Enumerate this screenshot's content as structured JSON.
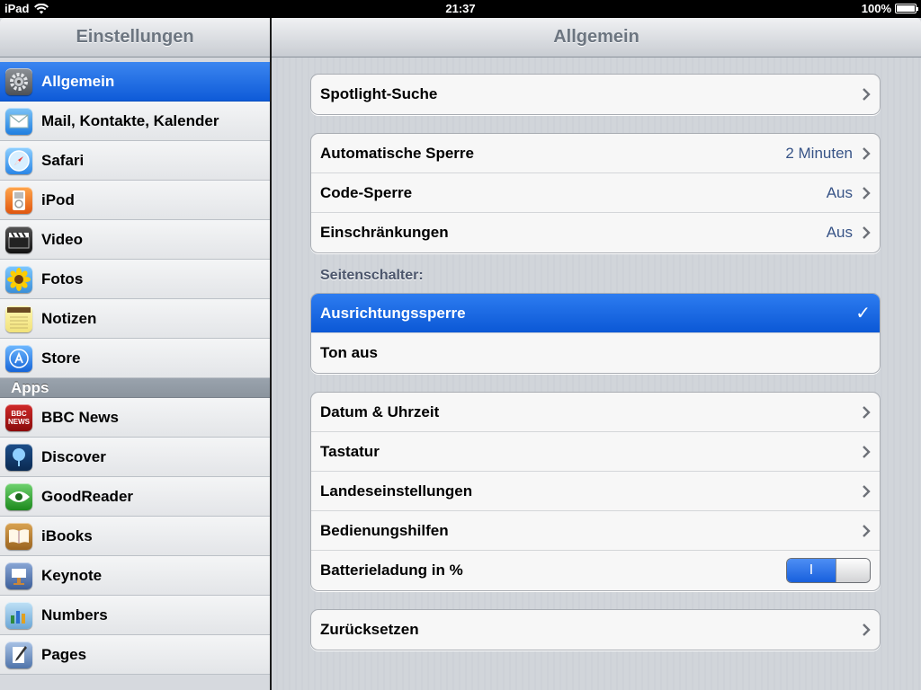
{
  "status": {
    "device": "iPad",
    "time": "21:37",
    "battery": "100%",
    "battery_level": 1.0
  },
  "master": {
    "title": "Einstellungen",
    "items": [
      {
        "label": "Allgemein",
        "icon": "gear-icon",
        "selected": true
      },
      {
        "label": "Mail, Kontakte, Kalender",
        "icon": "mail-icon"
      },
      {
        "label": "Safari",
        "icon": "compass-icon"
      },
      {
        "label": "iPod",
        "icon": "ipod-icon"
      },
      {
        "label": "Video",
        "icon": "clapperboard-icon"
      },
      {
        "label": "Fotos",
        "icon": "sunflower-icon"
      },
      {
        "label": "Notizen",
        "icon": "notepad-icon"
      },
      {
        "label": "Store",
        "icon": "app-store-icon"
      }
    ],
    "apps_header": "Apps",
    "apps": [
      {
        "label": "BBC News",
        "icon": "bbc-news-icon",
        "icon_text": "BBC NEWS"
      },
      {
        "label": "Discover",
        "icon": "tree-icon"
      },
      {
        "label": "GoodReader",
        "icon": "eye-icon"
      },
      {
        "label": "iBooks",
        "icon": "book-icon"
      },
      {
        "label": "Keynote",
        "icon": "keynote-icon"
      },
      {
        "label": "Numbers",
        "icon": "numbers-icon"
      },
      {
        "label": "Pages",
        "icon": "pages-icon"
      }
    ]
  },
  "detail": {
    "title": "Allgemein",
    "spotlight": "Spotlight-Suche",
    "auto_lock": {
      "label": "Automatische Sperre",
      "value": "2 Minuten"
    },
    "passcode": {
      "label": "Code-Sperre",
      "value": "Aus"
    },
    "restrictions": {
      "label": "Einschränkungen",
      "value": "Aus"
    },
    "side_switch_label": "Seitenschalter:",
    "orientation_lock": "Ausrichtungssperre",
    "mute": "Ton aus",
    "date_time": "Datum & Uhrzeit",
    "keyboard": "Tastatur",
    "international": "Landeseinstellungen",
    "accessibility": "Bedienungshilfen",
    "battery_percent": {
      "label": "Batterieladung in %",
      "toggle_text": "I",
      "on": true
    },
    "reset": "Zurücksetzen"
  },
  "colors": {
    "selection_blue": "#1866e0",
    "value_text": "#385487"
  }
}
